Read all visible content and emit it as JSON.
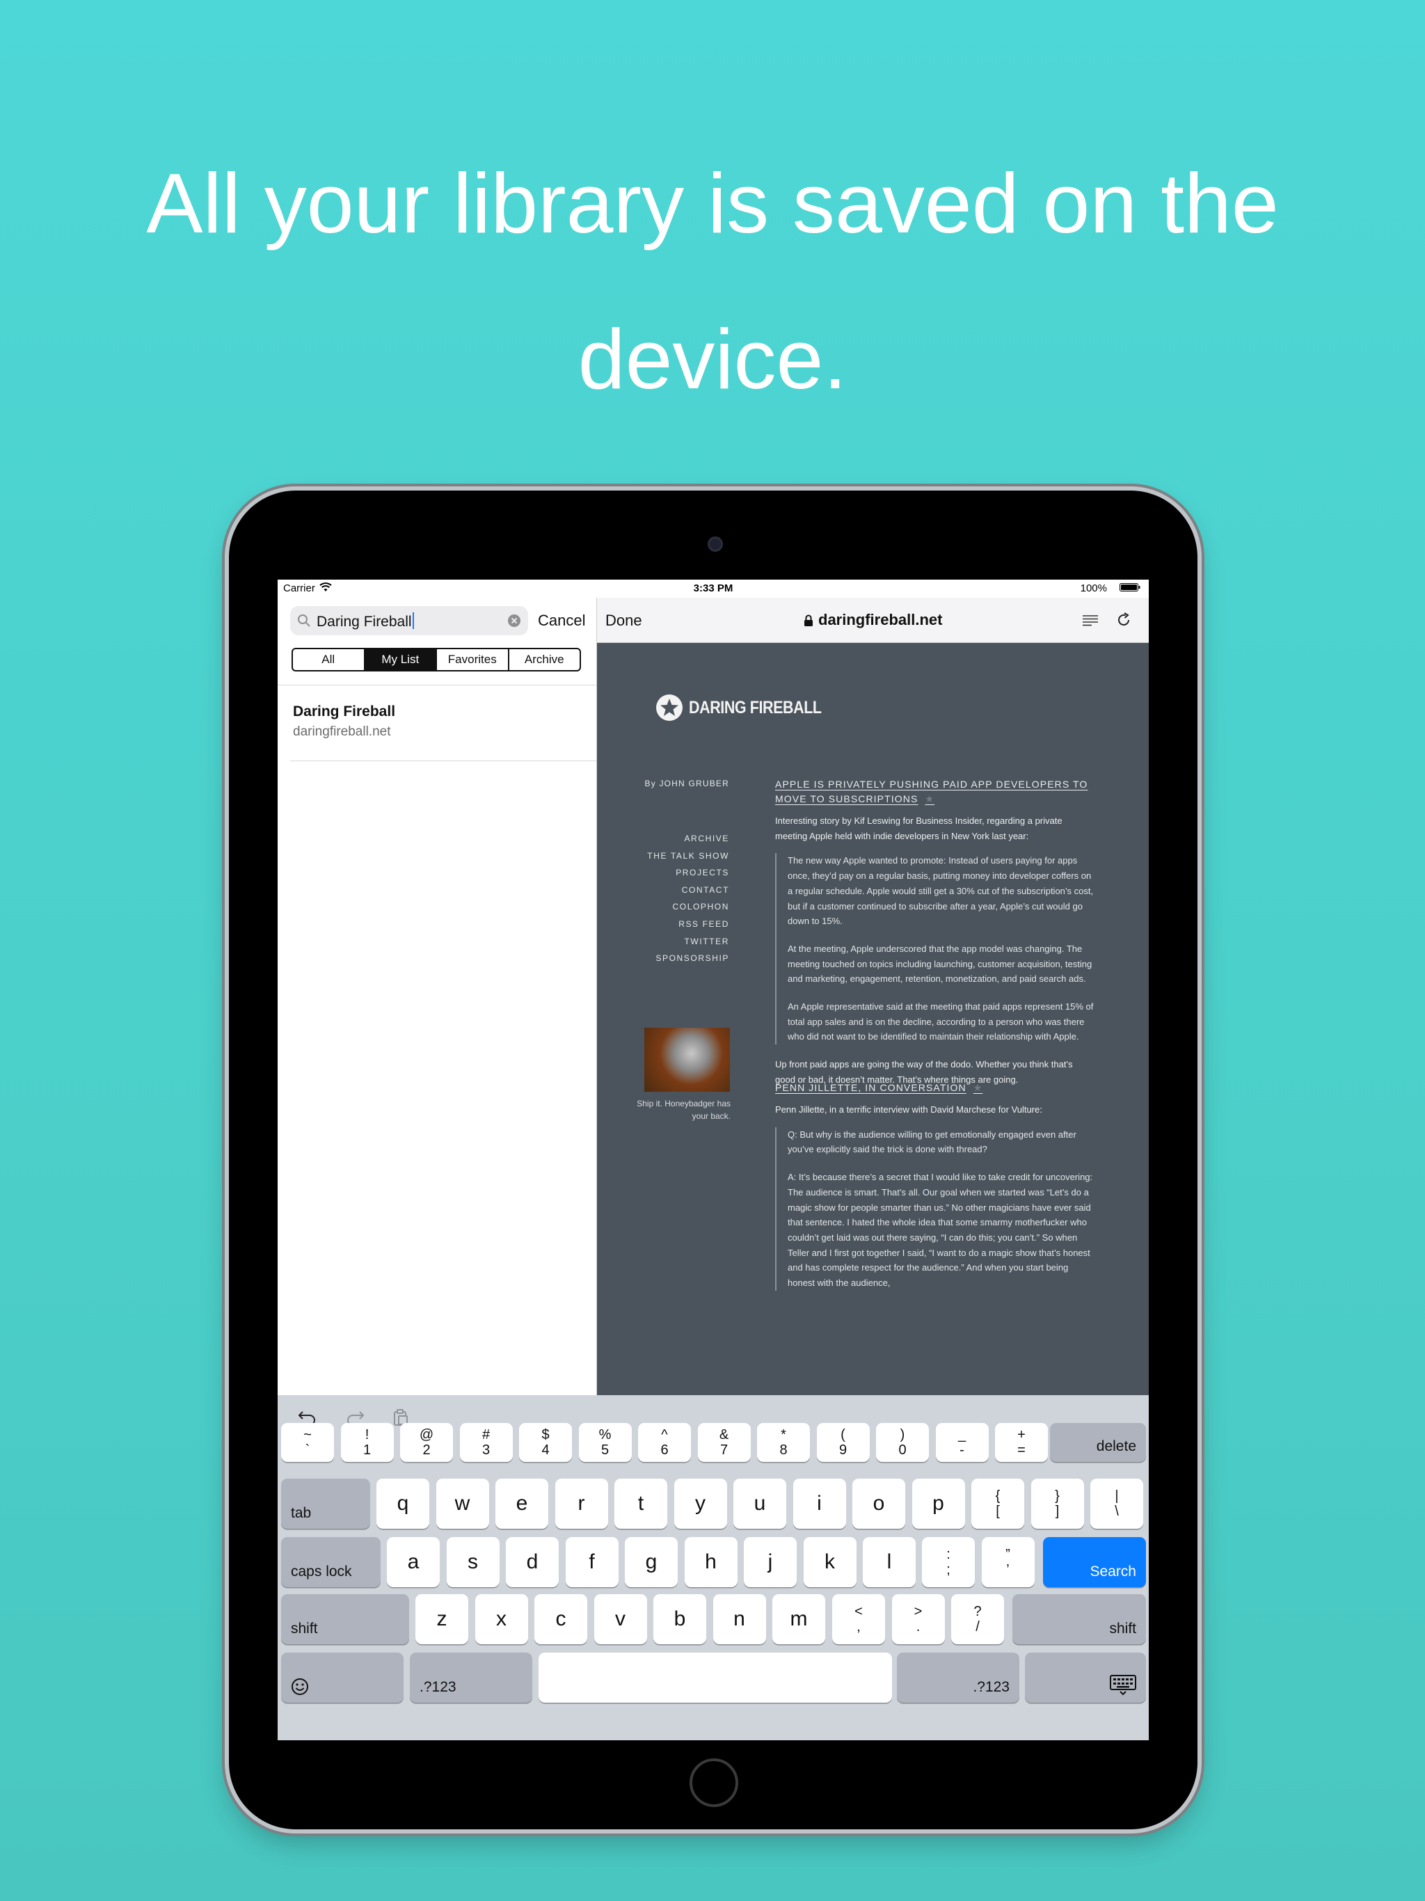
{
  "headline": {
    "line1": "All your library is saved on the",
    "line2": "device."
  },
  "status_bar": {
    "carrier": "Carrier",
    "time": "3:33 PM",
    "battery": "100%"
  },
  "left_pane": {
    "search": {
      "value": "Daring Fireball"
    },
    "cancel_label": "Cancel",
    "segments": [
      "All",
      "My List",
      "Favorites",
      "Archive"
    ],
    "selected_segment": "My List",
    "results": [
      {
        "title": "Daring Fireball",
        "subtitle": "daringfireball.net"
      }
    ]
  },
  "browser": {
    "done_label": "Done",
    "url": "daringfireball.net"
  },
  "site": {
    "logo": "DARING FIREBALL",
    "byline": "By JOHN GRUBER",
    "nav": [
      "ARCHIVE",
      "THE TALK SHOW",
      "PROJECTS",
      "CONTACT",
      "COLOPHON",
      "RSS FEED",
      "TWITTER",
      "SPONSORSHIP"
    ],
    "ad_caption_1": "Ship it. Honeybadger has",
    "ad_caption_2": "your back.",
    "article1": {
      "title_1": "APPLE IS PRIVATELY PUSHING PAID APP DEVELOPERS TO",
      "title_2": "MOVE TO SUBSCRIPTIONS",
      "intro": "Interesting story by Kif Leswing for Business Insider, regarding a private meeting Apple held with indie developers in New York last year:",
      "quote_1": "The new way Apple wanted to promote: Instead of users paying for apps once, they’d pay on a regular basis, putting money into developer coffers on a regular schedule. Apple would still get a 30% cut of the subscription’s cost, but if a customer continued to subscribe after a year, Apple’s cut would go down to 15%.",
      "quote_2": "At the meeting, Apple underscored that the app model was changing. The meeting touched on topics including launching, customer acquisition, testing and marketing, engagement, retention, monetization, and paid search ads.",
      "quote_3": "An Apple representative said at the meeting that paid apps represent 15% of total app sales and is on the decline, according to a person who was there who did not want to be identified to maintain their relationship with Apple.",
      "outro": "Up front paid apps are going the way of the dodo. Whether you think that’s good or bad, it doesn’t matter. That’s where things are going."
    },
    "article2": {
      "title": "PENN JILLETTE, IN CONVERSATION",
      "intro": "Penn Jillette, in a terrific interview with David Marchese for Vulture:",
      "quote_1": "Q: But why is the audience willing to get emotionally engaged even after you’ve explicitly said the trick is done with thread?",
      "quote_2": "A: It’s because there’s a secret that I would like to take credit for uncovering: The audience is smart. That’s all. Our goal when we started was “Let’s do a magic show for people smarter than us.” No other magicians have ever said that sentence. I hated the whole idea that some smarmy motherfucker who couldn’t get laid was out there saying, “I can do this; you can’t.” So when Teller and I first got together I said, “I want to do a magic show that’s honest and has complete respect for the audience.” And when you start being honest with the audience,"
    }
  },
  "keyboard": {
    "row1": [
      {
        "top": "~",
        "bottom": "`"
      },
      {
        "top": "!",
        "bottom": "1"
      },
      {
        "top": "@",
        "bottom": "2"
      },
      {
        "top": "#",
        "bottom": "3"
      },
      {
        "top": "$",
        "bottom": "4"
      },
      {
        "top": "%",
        "bottom": "5"
      },
      {
        "top": "^",
        "bottom": "6"
      },
      {
        "top": "&",
        "bottom": "7"
      },
      {
        "top": "*",
        "bottom": "8"
      },
      {
        "top": "(",
        "bottom": "9"
      },
      {
        "top": ")",
        "bottom": "0"
      },
      {
        "top": "_",
        "bottom": "-"
      },
      {
        "top": "+",
        "bottom": "="
      }
    ],
    "delete": "delete",
    "tab": "tab",
    "row2": [
      "q",
      "w",
      "e",
      "r",
      "t",
      "y",
      "u",
      "i",
      "o",
      "p"
    ],
    "row2_sym": [
      {
        "top": "{",
        "bottom": "["
      },
      {
        "top": "}",
        "bottom": "]"
      },
      {
        "top": "|",
        "bottom": "\\"
      }
    ],
    "caps_lock": "caps lock",
    "row3": [
      "a",
      "s",
      "d",
      "f",
      "g",
      "h",
      "j",
      "k",
      "l"
    ],
    "row3_sym": [
      {
        "top": ":",
        "bottom": ";"
      },
      {
        "top": "”",
        "bottom": "’"
      }
    ],
    "search": "Search",
    "shift": "shift",
    "row4": [
      "z",
      "x",
      "c",
      "v",
      "b",
      "n",
      "m"
    ],
    "row4_sym": [
      {
        "top": "<",
        "bottom": ","
      },
      {
        "top": ">",
        "bottom": "."
      },
      {
        "top": "?",
        "bottom": "/"
      }
    ],
    "numbers": ".?123"
  }
}
